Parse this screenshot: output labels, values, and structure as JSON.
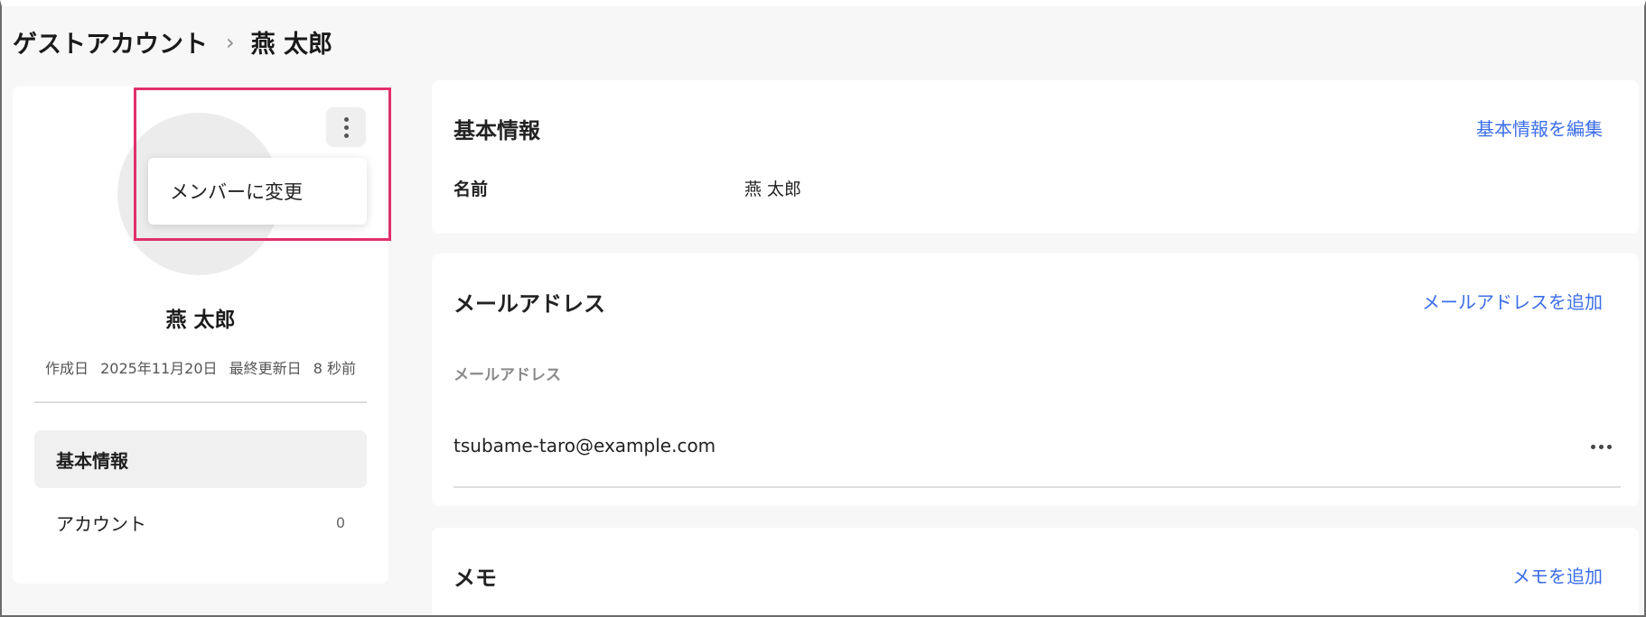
{
  "breadcrumb": {
    "parent": "ゲストアカウント",
    "separator": "›",
    "current": "燕 太郎"
  },
  "profile": {
    "name": "燕 太郎",
    "created_label": "作成日",
    "created_date": "2025年11月20日",
    "updated_label": "最終更新日",
    "updated_value": "8 秒前",
    "menu_icon": "kebab-vertical-icon",
    "dropdown": {
      "items": [
        "メンバーに変更"
      ]
    }
  },
  "sidebar": {
    "items": [
      {
        "label": "基本情報",
        "count": "",
        "active": true
      },
      {
        "label": "アカウント",
        "count": "0",
        "active": false
      }
    ]
  },
  "basic_info": {
    "title": "基本情報",
    "action": "基本情報を編集",
    "name_label": "名前",
    "name_value": "燕 太郎"
  },
  "email": {
    "title": "メールアドレス",
    "action": "メールアドレスを追加",
    "column_label": "メールアドレス",
    "rows": [
      {
        "address": "tsubame-taro@example.com",
        "menu_icon": "more-horizontal-icon"
      }
    ]
  },
  "memo": {
    "title": "メモ",
    "action": "メモを追加"
  },
  "colors": {
    "accent_link": "#3c6ee8",
    "highlight": "#e0306a",
    "avatar_badge": "#3b5ee0"
  }
}
